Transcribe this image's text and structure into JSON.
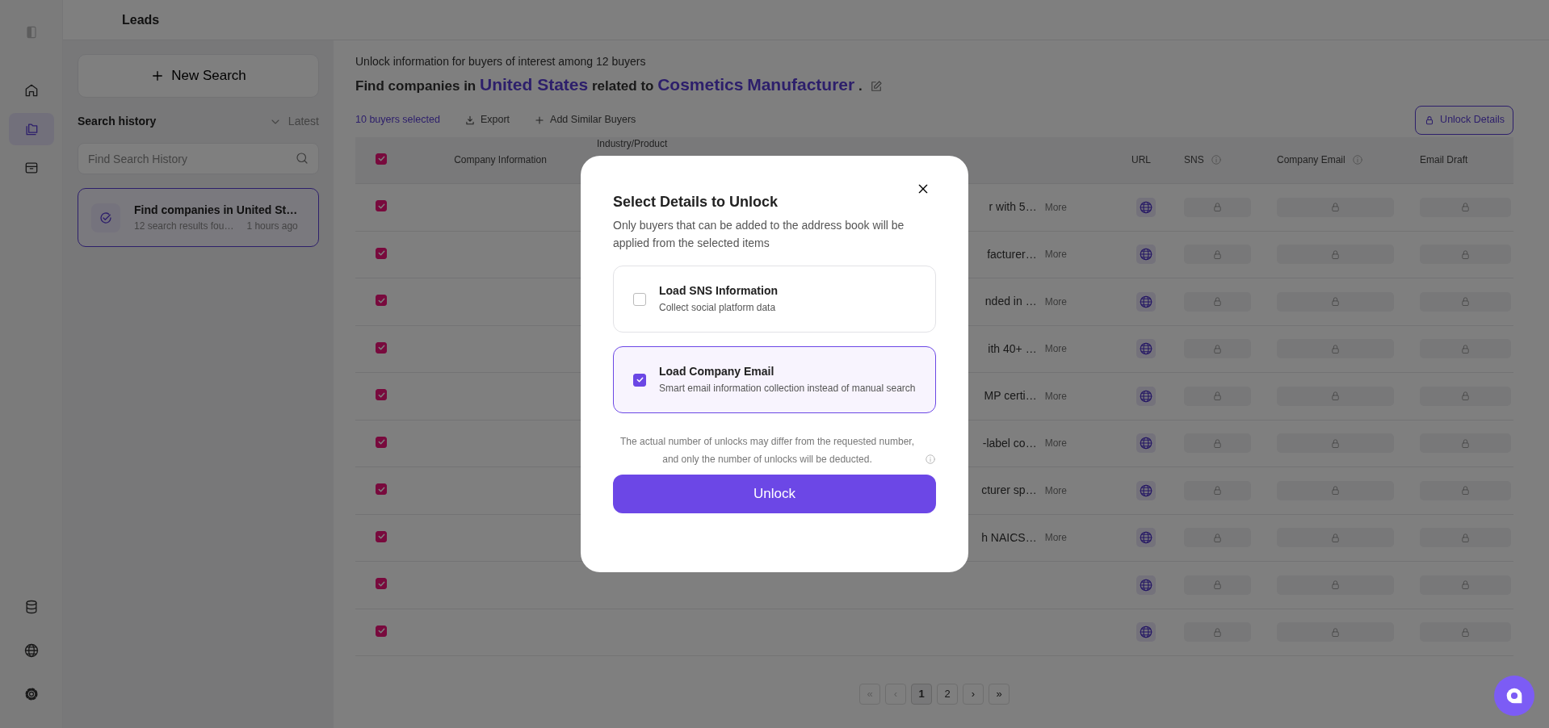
{
  "rail": {
    "nav": [
      {
        "kind": "home",
        "selected": false
      },
      {
        "kind": "folder",
        "selected": true
      },
      {
        "kind": "archive",
        "selected": false
      }
    ],
    "bottom": [
      {
        "kind": "database"
      },
      {
        "kind": "globe"
      },
      {
        "kind": "settings"
      }
    ]
  },
  "header": {
    "title": "Leads"
  },
  "history": {
    "new_search": "New Search",
    "title": "Search history",
    "sort": "Latest",
    "search": {
      "placeholder": "Find Search History"
    },
    "items": [
      {
        "title": "Find companies in United St…",
        "summary": "12 search results fou…",
        "time": "1 hours ago",
        "selected": true
      }
    ]
  },
  "main": {
    "subtitle": "Unlock information for buyers of interest among 12 buyers",
    "heading": [
      {
        "kind": "plain",
        "text": "Find companies in"
      },
      {
        "kind": "keyword",
        "text": "United States"
      },
      {
        "kind": "plain",
        "text": "related to"
      },
      {
        "kind": "keyword",
        "text": "Cosmetics"
      },
      {
        "kind": "keyword",
        "text": "Manufacturer"
      },
      {
        "kind": "plain",
        "text": "."
      }
    ],
    "selected_count": "10 buyers selected",
    "actions": [
      {
        "kind": "export",
        "label": "Export"
      },
      {
        "kind": "add",
        "label": "Add Similar Buyers"
      }
    ],
    "unlock_button": "Unlock Details"
  },
  "table": {
    "header_checked": true,
    "columns": [
      {
        "label": "Company Information",
        "info": false
      },
      {
        "label": "Industry/Product",
        "info": false
      },
      {
        "label": "URL",
        "info": false
      },
      {
        "label": "SNS",
        "info": true
      },
      {
        "label": "Company Email",
        "info": true
      },
      {
        "label": "Email Draft",
        "info": false
      }
    ],
    "rows": [
      {
        "checked": true,
        "industry": "r with 5…",
        "more": "More"
      },
      {
        "checked": true,
        "industry": "facturer…",
        "more": "More"
      },
      {
        "checked": true,
        "industry": "nded in …",
        "more": "More"
      },
      {
        "checked": true,
        "industry": "ith 40+ …",
        "more": "More"
      },
      {
        "checked": true,
        "industry": "MP certi…",
        "more": "More"
      },
      {
        "checked": true,
        "industry": "-label co…",
        "more": "More"
      },
      {
        "checked": true,
        "industry": "cturer sp…",
        "more": "More"
      },
      {
        "checked": true,
        "industry": "h NAICS…",
        "more": "More"
      },
      {
        "checked": true
      },
      {
        "checked": true
      }
    ]
  },
  "pagination": [
    {
      "label": "«",
      "selected": false,
      "disabled": true
    },
    {
      "label": "‹",
      "selected": false,
      "disabled": true
    },
    {
      "label": "1",
      "selected": true,
      "disabled": false
    },
    {
      "label": "2",
      "selected": false,
      "disabled": false
    },
    {
      "label": "›",
      "selected": false,
      "disabled": false
    },
    {
      "label": "»",
      "selected": false,
      "disabled": false
    }
  ],
  "modal": {
    "title": "Select Details to Unlock",
    "description": "Only buyers that can be added to the address book will be applied from the selected items",
    "options": [
      {
        "title": "Load SNS Information",
        "description": "Collect social platform data",
        "checked": false
      },
      {
        "title": "Load Company Email",
        "description": "Smart email information collection instead of manual search",
        "checked": true
      }
    ],
    "note": "The actual number of unlocks may differ from the requested number, and only the number of unlocks will be deducted.",
    "button": "Unlock"
  }
}
